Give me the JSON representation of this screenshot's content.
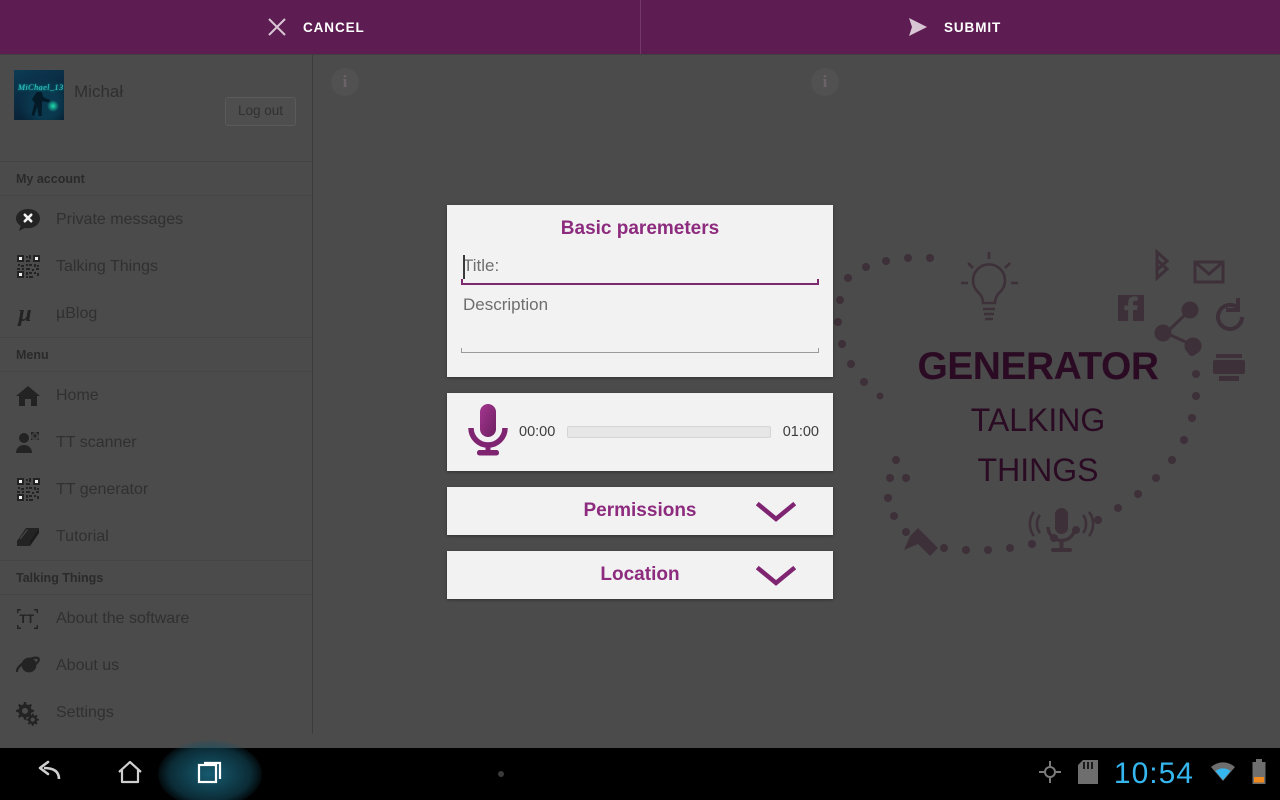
{
  "topbar": {
    "cancel_label": "CANCEL",
    "submit_label": "SUBMIT",
    "bg_color": "#5e1d52"
  },
  "sidebar": {
    "profile": {
      "name": "Michał",
      "avatar_text": "MiChael_13",
      "logout_label": "Log out"
    },
    "sections": [
      {
        "header": "My account",
        "items": [
          {
            "label": "Private messages",
            "icon": "chat-x-icon"
          },
          {
            "label": "Talking Things",
            "icon": "qr-code-icon"
          },
          {
            "label": "µBlog",
            "icon": "mu-icon"
          }
        ]
      },
      {
        "header": "Menu",
        "items": [
          {
            "label": "Home",
            "icon": "home-icon"
          },
          {
            "label": "TT scanner",
            "icon": "person-scan-icon"
          },
          {
            "label": "TT generator",
            "icon": "qr-code-icon"
          },
          {
            "label": "Tutorial",
            "icon": "book-icon"
          }
        ]
      },
      {
        "header": "Talking Things",
        "items": [
          {
            "label": "About the software",
            "icon": "tt-tag-icon"
          },
          {
            "label": "About us",
            "icon": "planet-icon"
          },
          {
            "label": "Settings",
            "icon": "gears-icon"
          }
        ]
      }
    ]
  },
  "content": {
    "info_badge": "i",
    "watermark": {
      "line1": "GENERATOR",
      "line2": "TALKING",
      "line3": "THINGS"
    }
  },
  "dialog": {
    "basic": {
      "title": "Basic paremeters",
      "title_field_value": "",
      "title_field_placeholder": "Title:",
      "desc_field_value": "",
      "desc_field_placeholder": "Description",
      "accent_color": "#8d2b7e"
    },
    "recorder": {
      "elapsed": "00:00",
      "duration": "01:00",
      "progress_percent": 0
    },
    "permissions_label": "Permissions",
    "location_label": "Location"
  },
  "navbar": {
    "clock": "10:54",
    "buttons": [
      {
        "name": "back",
        "icon": "back-arrow-icon"
      },
      {
        "name": "home",
        "icon": "home-outline-icon"
      },
      {
        "name": "recents",
        "icon": "recent-apps-icon"
      }
    ],
    "status_icons": [
      "gps-icon",
      "sd-card-icon",
      "wifi-icon",
      "battery-icon"
    ]
  }
}
